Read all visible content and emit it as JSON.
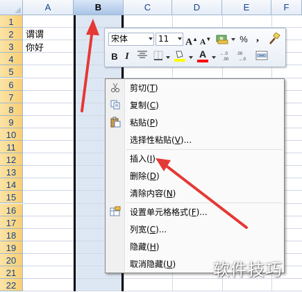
{
  "sheet": {
    "columns": [
      "A",
      "B",
      "C",
      "D",
      "E",
      "F"
    ],
    "selected_column": "B",
    "rows": [
      "1",
      "2",
      "3",
      "4",
      "5",
      "6",
      "7",
      "8",
      "9",
      "10",
      "11",
      "12",
      "13",
      "14",
      "15",
      "16",
      "17",
      "18",
      "19",
      "20",
      "21",
      "22"
    ],
    "cells": {
      "A2": "谓谓",
      "A3": "你好"
    }
  },
  "mini_toolbar": {
    "font_name": "宋体",
    "font_size": "11",
    "grow_font": "A",
    "shrink_font": "A",
    "percent": "%",
    "comma": ",",
    "bold": "B",
    "italic": "I",
    "font_color_letter": "A",
    "highlight_color": "#ffff00",
    "font_color": "#ff0000"
  },
  "context_menu": {
    "items": [
      {
        "label": "剪切(",
        "key": "T",
        "suffix": ")",
        "icon": "scissors-icon"
      },
      {
        "label": "复制(",
        "key": "C",
        "suffix": ")",
        "icon": "copy-icon"
      },
      {
        "label": "粘贴(",
        "key": "P",
        "suffix": ")",
        "icon": "paste-icon"
      },
      {
        "label": "选择性粘贴(",
        "key": "V",
        "suffix": ")..."
      },
      {
        "label": "插入(",
        "key": "I",
        "suffix": ")"
      },
      {
        "label": "删除(",
        "key": "D",
        "suffix": ")"
      },
      {
        "label": "清除内容(",
        "key": "N",
        "suffix": ")"
      },
      {
        "label": "设置单元格格式(",
        "key": "F",
        "suffix": ")...",
        "icon": "format-cells-icon"
      },
      {
        "label": "列宽(",
        "key": "C",
        "suffix": ")..."
      },
      {
        "label": "隐藏(",
        "key": "H",
        "suffix": ")"
      },
      {
        "label": "取消隐藏(",
        "key": "U",
        "suffix": ")"
      }
    ]
  },
  "watermark": "软件技巧",
  "colors": {
    "annotation_arrow": "#e53935",
    "header_blue_text": "#15428b",
    "row_header_fill": "#f9cf74",
    "selected_column_fill": "#d9e6f6"
  }
}
